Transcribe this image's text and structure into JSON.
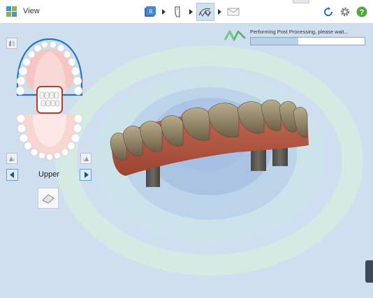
{
  "header": {
    "title": "View",
    "workflow_steps": [
      {
        "name": "rx-step",
        "icon": "rx-form-icon",
        "letter": "R"
      },
      {
        "name": "scan-step",
        "icon": "scan-wand-icon"
      },
      {
        "name": "view-step",
        "icon": "view-scan-icon"
      },
      {
        "name": "send-step",
        "icon": "envelope-icon"
      }
    ],
    "active_step": "view-step",
    "actions": [
      "sync-icon",
      "gear-icon",
      "help-icon"
    ],
    "colors": {
      "brand_blue": "#2a72c4",
      "brand_green": "#52a83c",
      "help_green": "#4ea83a"
    }
  },
  "progress": {
    "message": "Performing Post Processing, please wait...",
    "value_percent": 42
  },
  "jaw_selector": {
    "selected_arch": "Upper",
    "highlight_color": "#1f78c6",
    "selected_tooth_color": "#c0392b"
  },
  "viewport": {
    "model": "upper arch scan with implant abutments",
    "colors": {
      "gum": "#b5553c",
      "tooth": "#8a7a5b",
      "abutment": "#59554f"
    }
  }
}
